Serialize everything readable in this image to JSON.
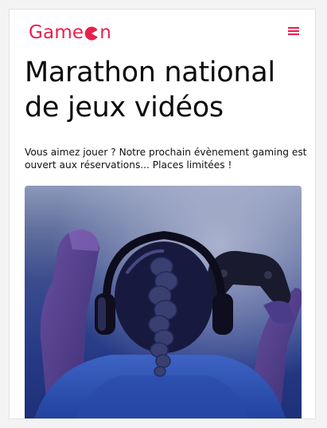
{
  "header": {
    "brand_left": "Game",
    "brand_right": "n",
    "brand_icon": "pacman-icon",
    "menu_icon": "hamburger-menu-icon",
    "accent_color": "#e8204c"
  },
  "hero": {
    "title_lines": [
      "Marathon national",
      "de jeux vidéos"
    ],
    "description_lines": [
      "Vous aimez jouer ? Notre prochain évènement gaming est",
      "ouvert aux réservations... Places limitées !"
    ],
    "image_subject": "gamer-with-headphones-and-controller"
  }
}
